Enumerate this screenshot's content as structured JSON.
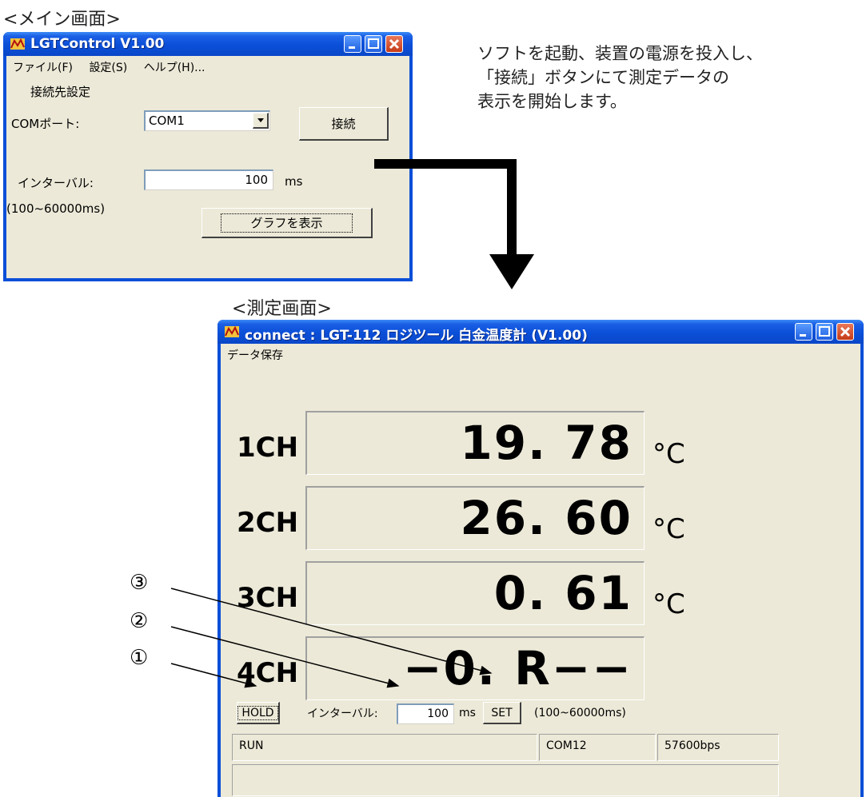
{
  "captions": {
    "main": "<メイン画面>",
    "measure": "<測定画面>",
    "description": [
      "ソフトを起動、装置の電源を投入し、",
      "「接続」ボタンにて測定データの",
      "表示を開始します。"
    ]
  },
  "main_window": {
    "title": "LGTControl V1.00",
    "menu": [
      "ファイル(F)",
      "設定(S)",
      "ヘルプ(H)..."
    ],
    "section_label": "接続先設定",
    "com_label": "COMポート:",
    "com_value": "COM1",
    "connect_button": "接続",
    "interval_label": "インターバル:",
    "interval_value": "100",
    "interval_unit": "ms",
    "range_note": "(100~60000ms)",
    "graph_button": "グラフを表示"
  },
  "measure_window": {
    "title": "connect : LGT-112 ロジツール 白金温度計 (V1.00)",
    "menu": [
      "データ保存"
    ],
    "channels": [
      {
        "label": "1CH",
        "value": "19. 78",
        "unit": "°C"
      },
      {
        "label": "2CH",
        "value": "26. 60",
        "unit": "°C"
      },
      {
        "label": "3CH",
        "value": "0. 61",
        "unit": "°C"
      },
      {
        "label": "4CH",
        "value": "−0. R−−",
        "unit": ""
      }
    ],
    "hold_button": "HOLD",
    "interval_label": "インターバル:",
    "interval_value": "100",
    "interval_unit": "ms",
    "set_button": "SET",
    "range_note": "(100~60000ms)",
    "status": {
      "state": "RUN",
      "port": "COM12",
      "baud": "57600bps"
    }
  },
  "callouts": [
    "③",
    "②",
    "①"
  ],
  "colors": {
    "titlebar": "#0a4fd8",
    "client": "#ece9d8",
    "close": "#c53a17"
  }
}
